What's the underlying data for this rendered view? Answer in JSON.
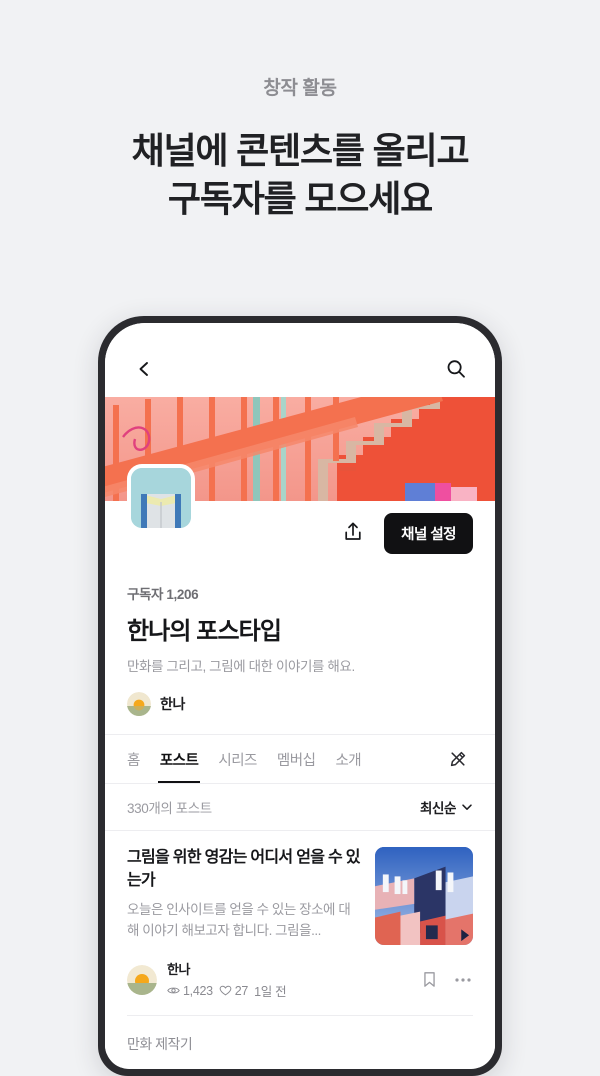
{
  "hero": {
    "eyebrow": "창작 활동",
    "title_line1": "채널에 콘텐츠를 올리고",
    "title_line2": "구독자를 모으세요"
  },
  "app": {
    "nav": {
      "back_label": "뒤로",
      "search_label": "검색"
    },
    "channel": {
      "subscribers": "구독자 1,206",
      "name": "한나의 포스타입",
      "description": "만화를 그리고, 그림에 대한 이야기를 해요.",
      "owner": "한나",
      "share_label": "공유",
      "settings_label": "채널 설정"
    },
    "tabs": [
      {
        "label": "홈",
        "active": false
      },
      {
        "label": "포스트",
        "active": true
      },
      {
        "label": "시리즈",
        "active": false
      },
      {
        "label": "멤버십",
        "active": false
      },
      {
        "label": "소개",
        "active": false
      }
    ],
    "write_label": "글쓰기",
    "list": {
      "count_label": "330개의 포스트",
      "sort_label": "최신순"
    },
    "posts": [
      {
        "title": "그림을 위한 영감는 어디서 얻을 수 있는가",
        "excerpt": "오늘은 인사이트를 얻을 수 있는 장소에 대해 이야기 해보고자 합니다. 그림을...",
        "author": "한나",
        "views": "1,423",
        "likes": "27",
        "time": "1일 전",
        "bookmark_label": "저장",
        "more_label": "더보기"
      },
      {
        "title": "만화 제작기"
      }
    ]
  },
  "colors": {
    "page_bg": "#f1f2f4",
    "accent_dark": "#111113",
    "muted_text": "#9a9aa0",
    "cover_coral": "#f2705a",
    "cover_pink": "#f6a196",
    "avatar_teal": "#a7d6dc"
  }
}
